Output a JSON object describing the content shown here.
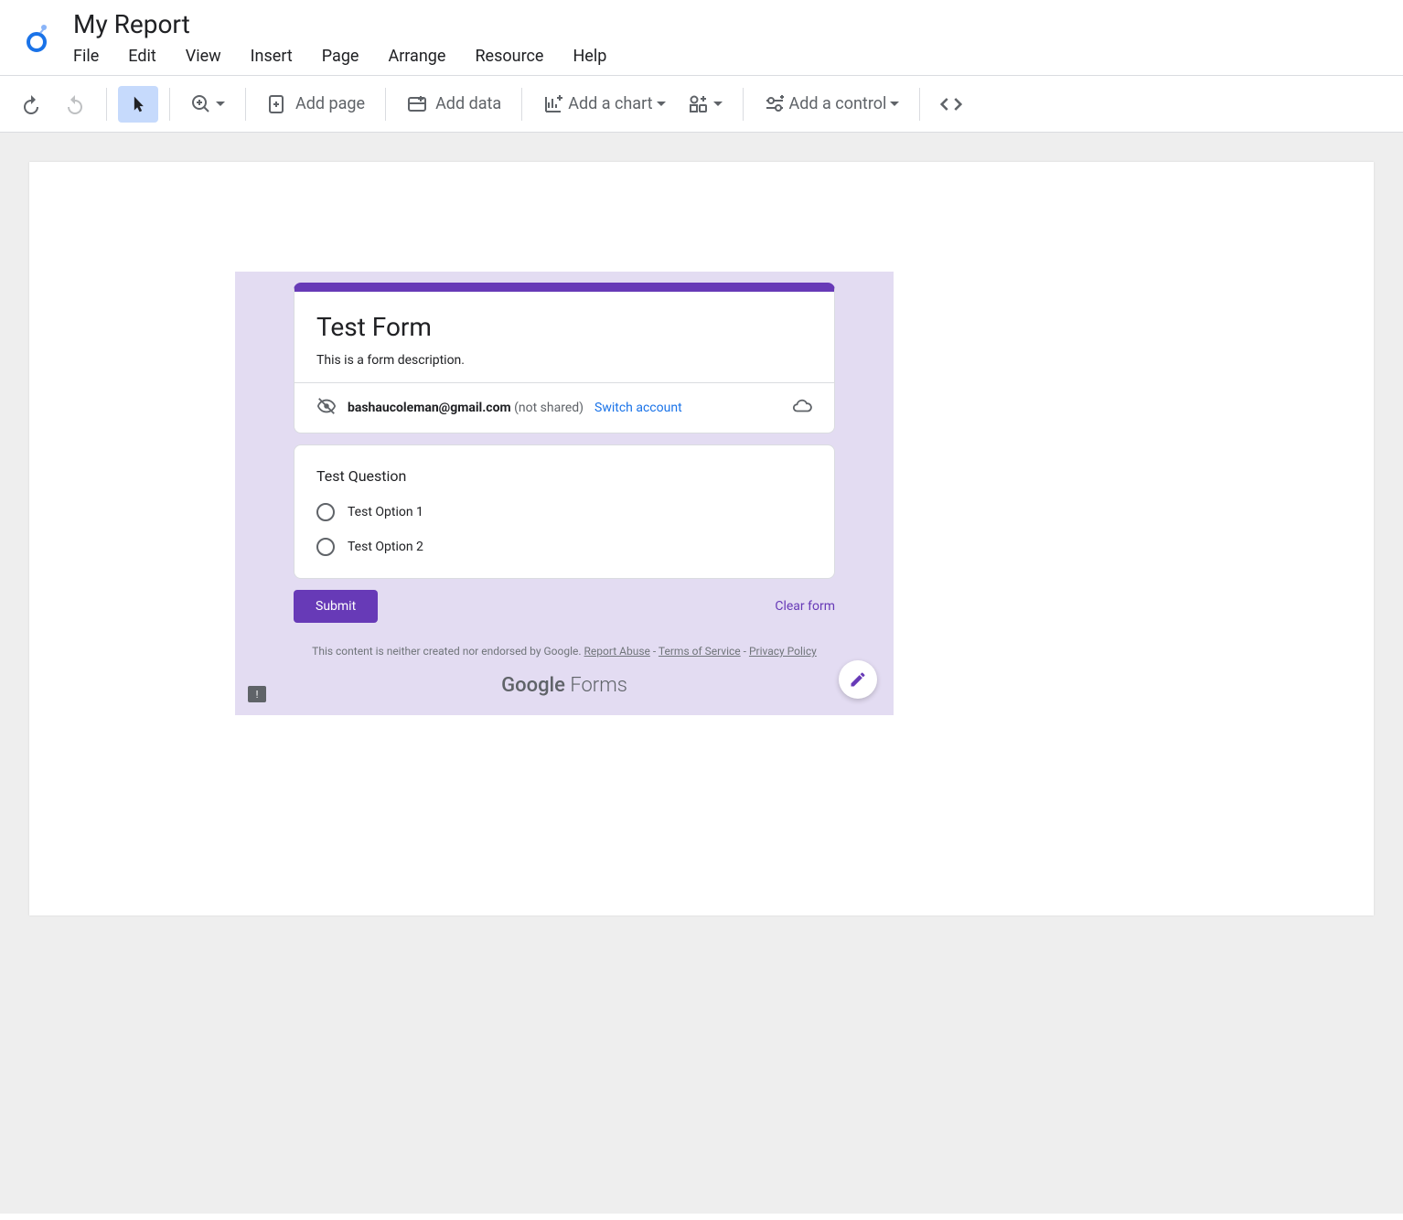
{
  "header": {
    "title": "My Report",
    "menu": [
      "File",
      "Edit",
      "View",
      "Insert",
      "Page",
      "Arrange",
      "Resource",
      "Help"
    ]
  },
  "toolbar": {
    "add_page": "Add page",
    "add_data": "Add data",
    "add_chart": "Add a chart",
    "add_control": "Add a control"
  },
  "form": {
    "title": "Test Form",
    "description": "This is a form description.",
    "account_email": "bashaucoleman@gmail.com",
    "not_shared_label": "(not shared)",
    "switch_account_label": "Switch account",
    "question": {
      "title": "Test Question",
      "options": [
        "Test Option 1",
        "Test Option 2"
      ]
    },
    "submit_label": "Submit",
    "clear_label": "Clear form",
    "disclaimer": "This content is neither created nor endorsed by Google. ",
    "links": {
      "report_abuse": "Report Abuse",
      "terms": "Terms of Service",
      "privacy": "Privacy Policy"
    },
    "branding_google": "Google",
    "branding_forms": " Forms"
  }
}
